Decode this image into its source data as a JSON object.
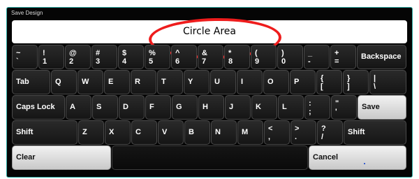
{
  "window": {
    "title": "Save Design"
  },
  "input": {
    "value": "Circle Area"
  },
  "colors": {
    "accent_border": "#2fb0a8",
    "annotation": "#ee1c1c"
  },
  "rows": {
    "r1": [
      {
        "up": "~",
        "lo": "`"
      },
      {
        "up": "!",
        "lo": "1"
      },
      {
        "up": "@",
        "lo": "2"
      },
      {
        "up": "#",
        "lo": "3"
      },
      {
        "up": "$",
        "lo": "4"
      },
      {
        "up": "%",
        "lo": "5"
      },
      {
        "up": "^",
        "lo": "6"
      },
      {
        "up": "&",
        "lo": "7"
      },
      {
        "up": "*",
        "lo": "8"
      },
      {
        "up": "(",
        "lo": "9"
      },
      {
        "up": ")",
        "lo": "0"
      },
      {
        "up": "_",
        "lo": "-"
      },
      {
        "up": "+",
        "lo": "="
      },
      {
        "label": "Backspace"
      }
    ],
    "r2": [
      {
        "label": "Tab"
      },
      {
        "label": "Q"
      },
      {
        "label": "W"
      },
      {
        "label": "E"
      },
      {
        "label": "R"
      },
      {
        "label": "T"
      },
      {
        "label": "Y"
      },
      {
        "label": "U"
      },
      {
        "label": "I"
      },
      {
        "label": "O"
      },
      {
        "label": "P"
      },
      {
        "up": "{",
        "lo": "["
      },
      {
        "up": "}",
        "lo": "]"
      },
      {
        "up": "|",
        "lo": "\\"
      }
    ],
    "r3": [
      {
        "label": "Caps Lock"
      },
      {
        "label": "A"
      },
      {
        "label": "S"
      },
      {
        "label": "D"
      },
      {
        "label": "F"
      },
      {
        "label": "G"
      },
      {
        "label": "H"
      },
      {
        "label": "J"
      },
      {
        "label": "K"
      },
      {
        "label": "L"
      },
      {
        "up": ":",
        "lo": ";"
      },
      {
        "up": "\"",
        "lo": "'"
      },
      {
        "label": "Save"
      }
    ],
    "r4": [
      {
        "label": "Shift"
      },
      {
        "label": "Z"
      },
      {
        "label": "X"
      },
      {
        "label": "C"
      },
      {
        "label": "V"
      },
      {
        "label": "B"
      },
      {
        "label": "N"
      },
      {
        "label": "M"
      },
      {
        "up": "<",
        "lo": ","
      },
      {
        "up": ">",
        "lo": "."
      },
      {
        "up": "?",
        "lo": "/"
      },
      {
        "label": "Shift"
      }
    ],
    "r5": [
      {
        "label": "Clear"
      },
      {
        "label": ""
      },
      {
        "label": "Cancel"
      }
    ]
  }
}
